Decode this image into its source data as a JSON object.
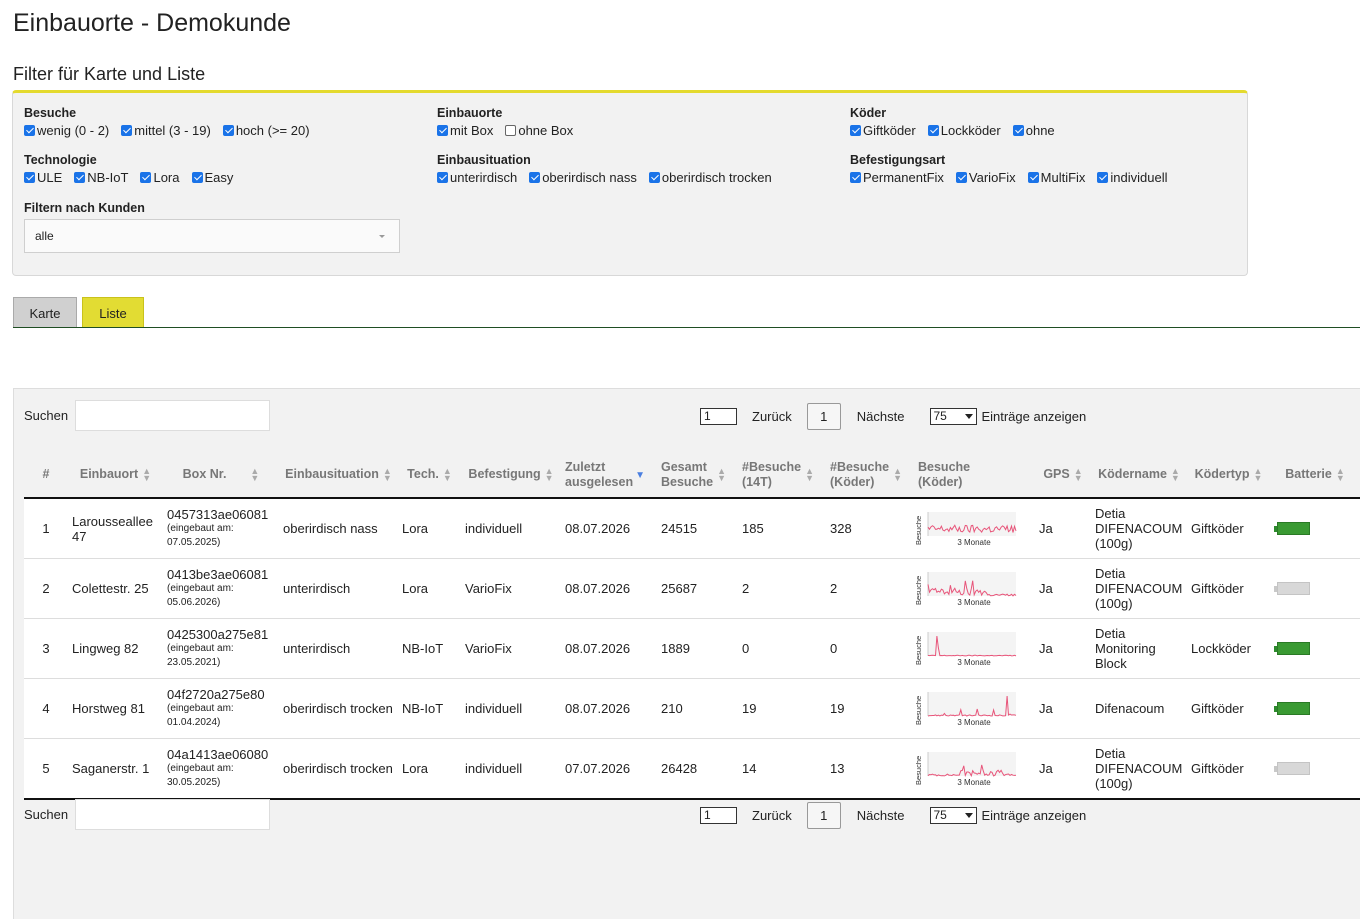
{
  "page": {
    "title": "Einbauorte - Demokunde",
    "subtitle": "Filter für Karte und Liste"
  },
  "filters": {
    "besuche": {
      "label": "Besuche",
      "options": [
        {
          "label": "wenig (0 - 2)",
          "checked": true
        },
        {
          "label": "mittel (3 - 19)",
          "checked": true
        },
        {
          "label": "hoch (>= 20)",
          "checked": true
        }
      ]
    },
    "einbauorte": {
      "label": "Einbauorte",
      "options": [
        {
          "label": "mit Box",
          "checked": true
        },
        {
          "label": "ohne Box",
          "checked": false
        }
      ]
    },
    "koeder": {
      "label": "Köder",
      "options": [
        {
          "label": "Giftköder",
          "checked": true
        },
        {
          "label": "Lockköder",
          "checked": true
        },
        {
          "label": "ohne",
          "checked": true
        }
      ]
    },
    "technologie": {
      "label": "Technologie",
      "options": [
        {
          "label": "ULE",
          "checked": true
        },
        {
          "label": "NB-IoT",
          "checked": true
        },
        {
          "label": "Lora",
          "checked": true
        },
        {
          "label": "Easy",
          "checked": true
        }
      ]
    },
    "einbausituation": {
      "label": "Einbausituation",
      "options": [
        {
          "label": "unterirdisch",
          "checked": true
        },
        {
          "label": "oberirdisch nass",
          "checked": true
        },
        {
          "label": "oberirdisch trocken",
          "checked": true
        }
      ]
    },
    "befestigungsart": {
      "label": "Befestigungsart",
      "options": [
        {
          "label": "PermanentFix",
          "checked": true
        },
        {
          "label": "VarioFix",
          "checked": true
        },
        {
          "label": "MultiFix",
          "checked": true
        },
        {
          "label": "individuell",
          "checked": true
        }
      ]
    },
    "kunden": {
      "label": "Filtern nach Kunden",
      "value": "alle"
    }
  },
  "tabs": {
    "karte": "Karte",
    "liste": "Liste",
    "active": "Liste"
  },
  "controls": {
    "search_label": "Suchen",
    "page_value": "1",
    "back_label": "Zurück",
    "current_page": "1",
    "next_label": "Nächste",
    "entries_value": "75",
    "entries_label": "Einträge anzeigen"
  },
  "table": {
    "headers": {
      "num": "#",
      "einbauort": "Einbauort",
      "box": "Box Nr.",
      "situation": "Einbausituation",
      "tech": "Tech.",
      "befestigung": "Befestigung",
      "zuletzt_1": "Zuletzt",
      "zuletzt_2": "ausgelesen",
      "gesamt_1": "Gesamt",
      "gesamt_2": "Besuche",
      "b14_1": "#Besuche",
      "b14_2": "(14T)",
      "bk_1": "#Besuche",
      "bk_2": "(Köder)",
      "chart_1": "Besuche",
      "chart_2": "(Köder)",
      "gps": "GPS",
      "koedername": "Ködername",
      "koedertyp": "Ködertyp",
      "batterie": "Batterie"
    },
    "spark_ylabel": "Besuche",
    "spark_xlabel": "3 Monate",
    "rows": [
      {
        "num": "1",
        "einbauort": "Larousseallee 47",
        "box": "0457313ae06081",
        "eingebaut": "(eingebaut am: 07.05.2025)",
        "situation": "oberirdisch nass",
        "tech": "Lora",
        "befestigung": "individuell",
        "zuletzt": "08.07.2026",
        "gesamt": "24515",
        "b14": "185",
        "bk": "328",
        "gps": "Ja",
        "koedername": "Detia DIFENACOUM (100g)",
        "koedertyp": "Giftköder",
        "battery": "full",
        "spark": "dense"
      },
      {
        "num": "2",
        "einbauort": "Colettestr. 25",
        "box": "0413be3ae06081",
        "eingebaut": "(eingebaut am: 05.06.2026)",
        "situation": "unterirdisch",
        "tech": "Lora",
        "befestigung": "VarioFix",
        "zuletzt": "08.07.2026",
        "gesamt": "25687",
        "b14": "2",
        "bk": "2",
        "gps": "Ja",
        "koedername": "Detia DIFENACOUM (100g)",
        "koedertyp": "Giftköder",
        "battery": "empty",
        "spark": "early"
      },
      {
        "num": "3",
        "einbauort": "Lingweg 82",
        "box": "0425300a275e81",
        "eingebaut": "(eingebaut am: 23.05.2021)",
        "situation": "unterirdisch",
        "tech": "NB-IoT",
        "befestigung": "VarioFix",
        "zuletzt": "08.07.2026",
        "gesamt": "1889",
        "b14": "0",
        "bk": "0",
        "gps": "Ja",
        "koedername": "Detia Monitoring Block",
        "koedertyp": "Lockköder",
        "battery": "full",
        "spark": "spike"
      },
      {
        "num": "4",
        "einbauort": "Horstweg 81",
        "box": "04f2720a275e80",
        "eingebaut": "(eingebaut am: 01.04.2024)",
        "situation": "oberirdisch trocken",
        "tech": "NB-IoT",
        "befestigung": "individuell",
        "zuletzt": "08.07.2026",
        "gesamt": "210",
        "b14": "19",
        "bk": "19",
        "gps": "Ja",
        "koedername": "Difenacoum",
        "koedertyp": "Giftköder",
        "battery": "full",
        "spark": "sparse"
      },
      {
        "num": "5",
        "einbauort": "Saganerstr. 1",
        "box": "04a1413ae06080",
        "eingebaut": "(eingebaut am: 30.05.2025)",
        "situation": "oberirdisch trocken",
        "tech": "Lora",
        "befestigung": "individuell",
        "zuletzt": "07.07.2026",
        "gesamt": "26428",
        "b14": "14",
        "bk": "13",
        "gps": "Ja",
        "koedername": "Detia DIFENACOUM (100g)",
        "koedertyp": "Giftköder",
        "battery": "empty",
        "spark": "mid"
      }
    ]
  },
  "colors": {
    "accent": "#e2dc33",
    "checkbox": "#1a73e8",
    "battery_full": "#3a9a33",
    "battery_empty": "#d8d8d8",
    "spark_line": "#e8557a"
  }
}
